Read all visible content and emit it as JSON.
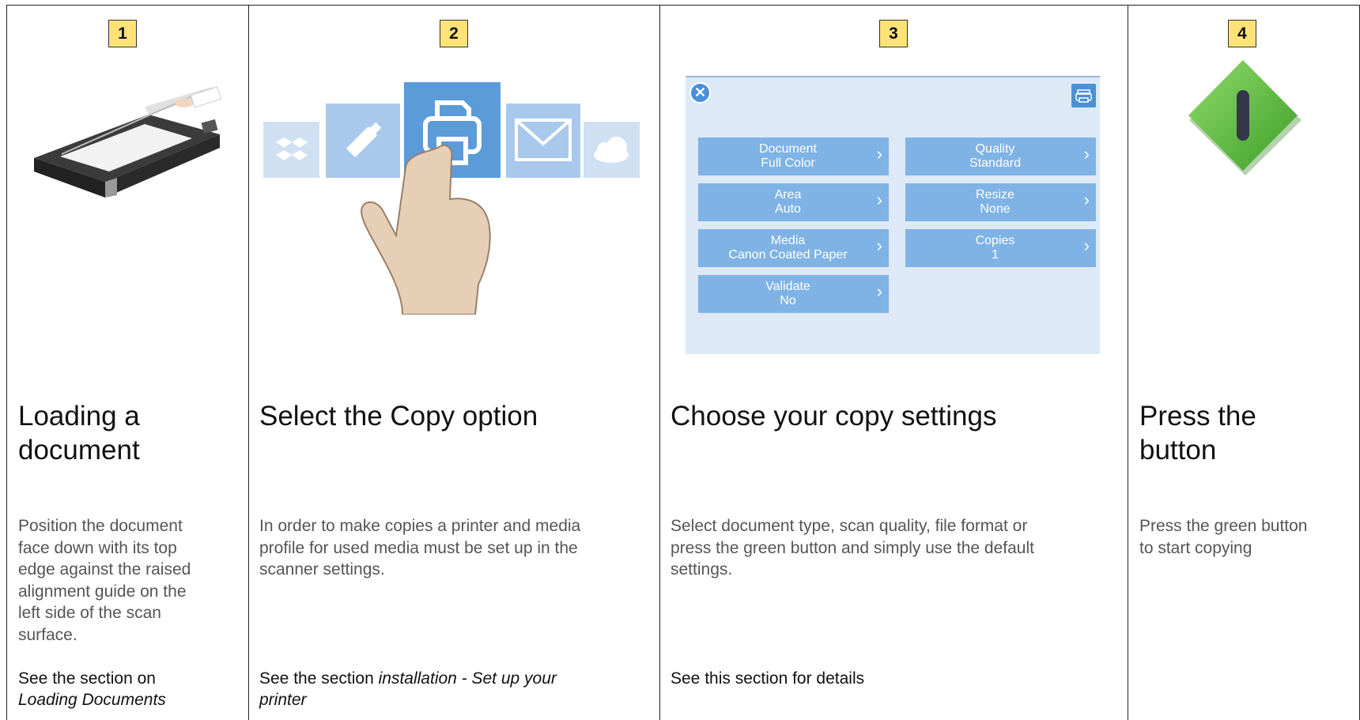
{
  "steps": [
    {
      "number": "1",
      "title_line1": "Loading a",
      "title_line2": "document",
      "desc_lines": [
        "Position the document",
        "face down with its top",
        "edge against the raised",
        "alignment guide on the",
        "left side of the scan",
        "surface."
      ],
      "see_text": "See the section on",
      "see_link": "Loading Documents"
    },
    {
      "number": "2",
      "title": "Select the Copy option",
      "desc_lines": [
        "In order to make copies a printer and media",
        "profile for used media must be set up in the",
        "scanner settings."
      ],
      "see_text": "See the section ",
      "see_link_line1": "installation - Set up your",
      "see_link_line2": "printer"
    },
    {
      "number": "3",
      "title": "Choose your copy settings",
      "desc_lines": [
        "Select document type, scan quality, file format or",
        "press the green button and simply use the default",
        "settings."
      ],
      "see_text": "See this section for details"
    },
    {
      "number": "4",
      "title_line1": "Press the",
      "title_line2": "button",
      "desc_lines": [
        "Press the green button",
        "to start copying"
      ]
    }
  ],
  "settings_buttons": [
    {
      "label": "Document",
      "value": "Full Color"
    },
    {
      "label": "Quality",
      "value": "Standard"
    },
    {
      "label": "Area",
      "value": "Auto"
    },
    {
      "label": "Resize",
      "value": "None"
    },
    {
      "label": "Media",
      "value": "Canon Coated Paper"
    },
    {
      "label": "Copies",
      "value": "1"
    },
    {
      "label": "Validate",
      "value": "No"
    }
  ],
  "icons": {
    "close": "close-icon",
    "printer": "printer-icon",
    "chevron": "chevron-right-icon"
  },
  "colors": {
    "badge": "#fde277",
    "panel": "#dde9f7",
    "button": "#7fb3e6",
    "accent": "#4a90d9",
    "green_button": "#5bbf3a"
  }
}
